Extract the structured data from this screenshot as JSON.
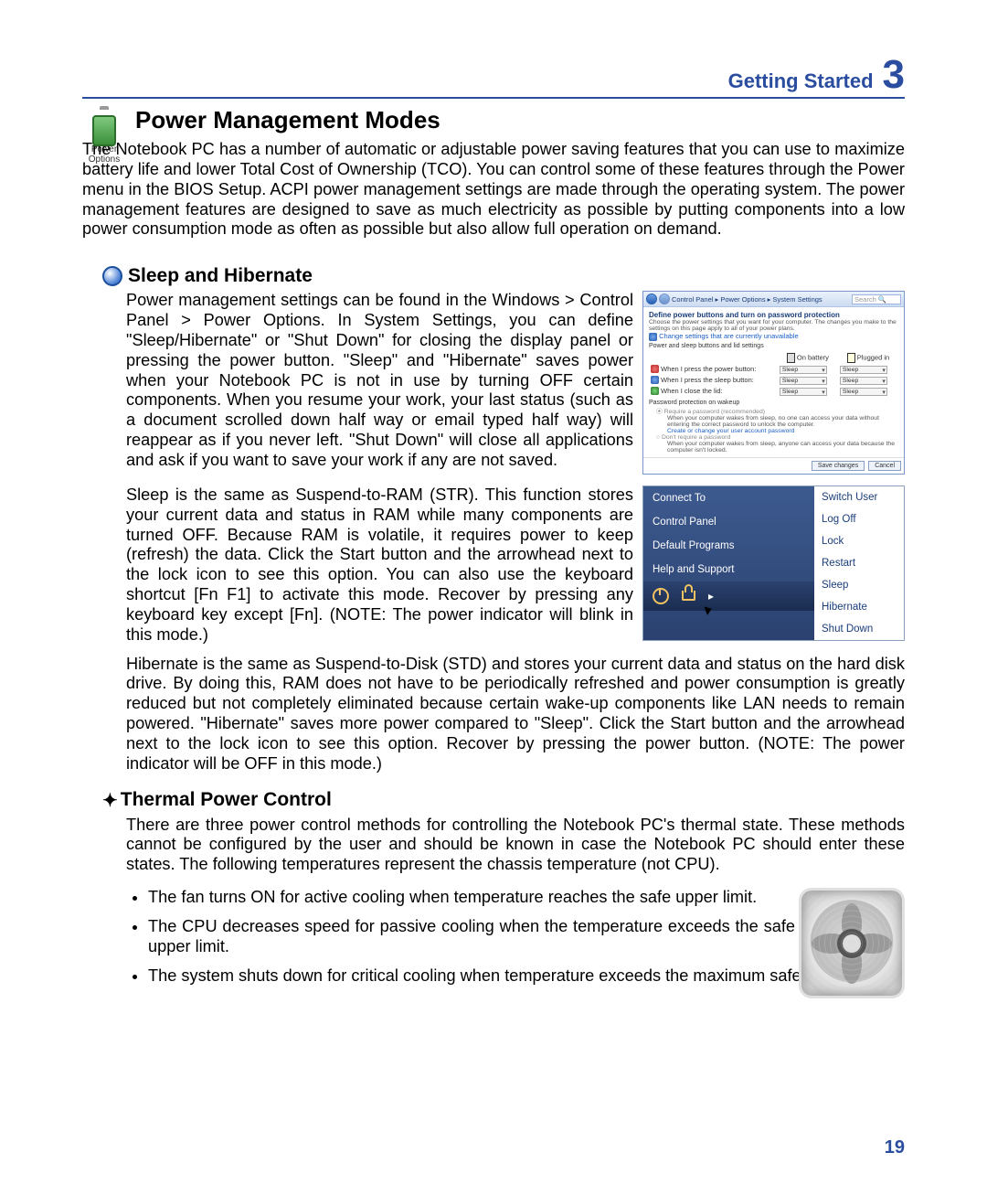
{
  "header": {
    "section": "Getting Started",
    "chapter": "3"
  },
  "icon_caption": "Power\nOptions",
  "h1": "Power Management Modes",
  "p_intro": "The Notebook PC has a number of automatic or adjustable power saving features that you can use to maximize battery life and lower Total Cost of Ownership (TCO). You can control some of these features through the Power menu in the BIOS Setup. ACPI power management settings are made through the operating system. The power management features are designed to save as much electricity as possible by putting components into a low power consumption mode as often as possible but also allow full operation on demand.",
  "h2_sleep": "Sleep and Hibernate",
  "p_sleep1": "Power management settings can be found in the Windows > Control Panel > Power Options. In System Settings, you can define \"Sleep/Hibernate\" or \"Shut Down\" for closing the display panel or pressing the power button. \"Sleep\" and \"Hibernate\" saves power when your Notebook PC is not in use by turning OFF certain components. When you resume your work, your last status (such as a document scrolled down half way or email typed half way) will reappear as if you never left. \"Shut Down\" will close all applications and ask if you want to save your work if any are not saved.",
  "p_sleep2": "Sleep is the same as Suspend-to-RAM (STR). This function stores your current data and status in RAM while many components are turned OFF. Because RAM is volatile, it requires power to keep (refresh) the data. Click the Start button and the arrowhead next to the lock icon to see this option. You can also use the keyboard shortcut [Fn F1] to activate this mode. Recover by pressing any keyboard key except [Fn]. (NOTE: The power indicator will blink in this mode.)",
  "p_sleep3": "Hibernate is the same as  Suspend-to-Disk (STD) and stores your current data and status on the hard disk drive. By doing this, RAM does not have to be periodically refreshed and power consumption is greatly reduced but not completely eliminated because certain wake-up components like LAN needs to remain powered. \"Hibernate\" saves more power compared to \"Sleep\". Click the Start button and the arrowhead next to the lock icon to see this option. Recover by pressing the power button. (NOTE: The power indicator will be OFF in this mode.)",
  "h2_thermal": "Thermal Power Control",
  "p_thermal": "There are three power control methods for controlling the Notebook PC's thermal state. These methods cannot be configured by the user and should be known in case the Notebook PC should enter these states. The following temperatures represent the chassis temperature (not CPU).",
  "bullets": [
    "The fan turns ON for active cooling when temperature reaches the safe upper limit.",
    "The CPU decreases speed for passive cooling when the temperature exceeds the safe upper limit.",
    "The system shuts down for critical cooling when temperature exceeds the maximum safe upper limit."
  ],
  "page_number": "19",
  "sys_window": {
    "breadcrumb": "Control Panel ▸ Power Options ▸ System Settings",
    "search_placeholder": "Search",
    "title": "Define power buttons and turn on password protection",
    "subtitle": "Choose the power settings that you want for your computer. The changes you make to the settings on this page apply to all of your power plans.",
    "link": "Change settings that are currently unavailable",
    "section1": "Power and sleep buttons and lid settings",
    "col_battery": "On battery",
    "col_plugged": "Plugged in",
    "row1": "When I press the power button:",
    "row2": "When I press the sleep button:",
    "row3": "When I close the lid:",
    "opt": "Sleep",
    "section2": "Password protection on wakeup",
    "radio1": "Require a password (recommended)",
    "radio1_desc": "When your computer wakes from sleep, no one can access your data without entering the correct password to unlock the computer.",
    "radio1_link": "Create or change your user account password",
    "radio2": "Don't require a password",
    "radio2_desc": "When your computer wakes from sleep, anyone can access your data because the computer isn't locked.",
    "btn_save": "Save changes",
    "btn_cancel": "Cancel"
  },
  "start_menu": {
    "left": [
      "Connect To",
      "Control Panel",
      "Default Programs",
      "Help and Support"
    ],
    "right": [
      "Switch User",
      "Log Off",
      "Lock",
      "Restart",
      "Sleep",
      "Hibernate",
      "Shut Down"
    ]
  }
}
